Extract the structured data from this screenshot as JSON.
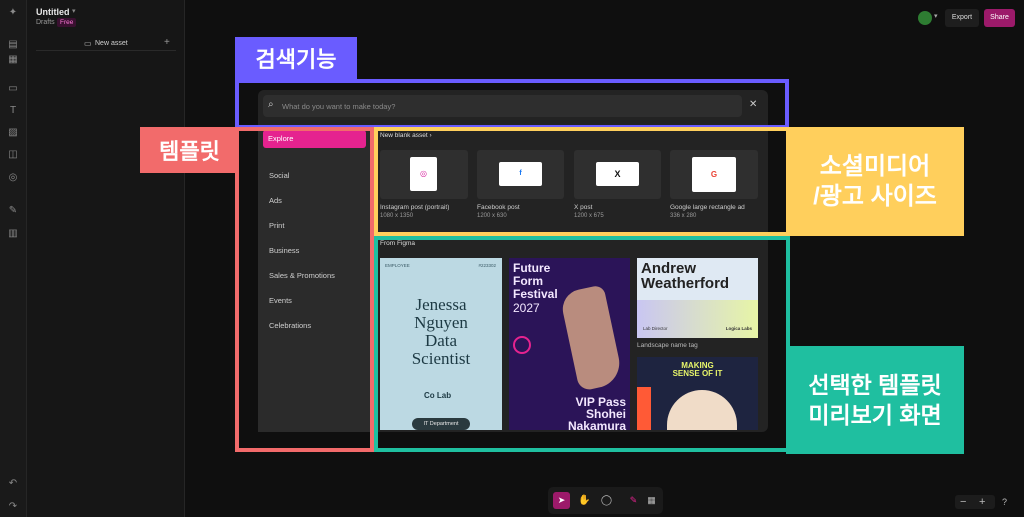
{
  "file": {
    "title": "Untitled",
    "location": "Drafts",
    "plan_badge": "Free"
  },
  "panel": {
    "new_asset": "New asset"
  },
  "toolbar": {
    "export": "Export",
    "share": "Share"
  },
  "search": {
    "placeholder": "What do you want to make today?"
  },
  "categories": [
    "Explore",
    "Social",
    "Ads",
    "Print",
    "Business",
    "Sales & Promotions",
    "Events",
    "Celebrations"
  ],
  "new_blank": {
    "heading": "New blank asset",
    "items": [
      {
        "name": "Instagram post (portrait)",
        "size": "1080 x 1350",
        "icon": "instagram-icon"
      },
      {
        "name": "Facebook post",
        "size": "1200 x 630",
        "icon": "facebook-icon"
      },
      {
        "name": "X post",
        "size": "1200 x 675",
        "icon": "x-icon"
      },
      {
        "name": "Google large rectangle ad",
        "size": "336 x 280",
        "icon": "google-icon"
      }
    ]
  },
  "from_figma": {
    "heading": "From Figma",
    "employee": {
      "label": "EMPLOYEE",
      "id": "#223302",
      "name_lines": [
        "Jenessa",
        "Nguyen",
        "Data",
        "Scientist"
      ],
      "logo": "Co Lab",
      "pill": "IT Department"
    },
    "festival": {
      "title_lines": [
        "Future",
        "Form",
        "Festival"
      ],
      "year": "2027",
      "pass": "VIP Pass",
      "holder_lines": [
        "Shohei",
        "Nakamura"
      ]
    },
    "name_tag": {
      "name_lines": [
        "Andrew",
        "Weatherford"
      ],
      "role": "Lab Director",
      "company": "Logica Labs",
      "caption": "Landscape name tag"
    },
    "poster": {
      "lines": [
        "MAKING",
        "SENSE OF IT"
      ]
    }
  },
  "annotations": {
    "search": "검색기능",
    "templates": "템플릿",
    "sizes_line1": "소셜미디어",
    "sizes_line2": "/광고 사이즈",
    "preview_line1": "선택한 템플릿",
    "preview_line2": "미리보기 화면"
  },
  "colors": {
    "accent": "#e5238f",
    "share": "#9c1a6a",
    "annot_blue": "#6a5cff",
    "annot_red": "#f26b6b",
    "annot_yellow": "#ffcf5c",
    "annot_teal": "#1fbfa0"
  }
}
